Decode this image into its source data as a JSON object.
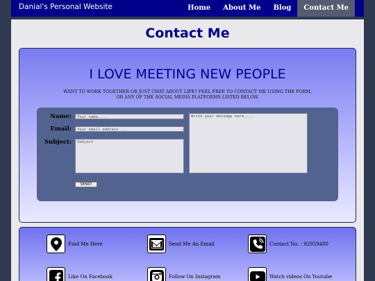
{
  "nav": {
    "brand": "Danial's Personal Website",
    "links": [
      "Home",
      "About Me",
      "Blog",
      "Contact Me"
    ],
    "active_index": 3
  },
  "page_title": "Contact Me",
  "contact": {
    "headline": "I LOVE MEETING NEW PEOPLE",
    "intro_line1": "WANT TO WORK TOGETHER OR JUST CHAT ABOUT LIFE? FEEL FREE TO CONTACT ME USING THE FORM,",
    "intro_line2": "OR ANY OF THE SOCIAL MEDIA PLATFORMS LISTED BELOW.",
    "form": {
      "name_label": "Name:",
      "name_placeholder": "Your name....",
      "email_label": "Email:",
      "email_placeholder": "Your email address ...",
      "subject_label": "Subject:",
      "subject_placeholder": "Subject",
      "message_placeholder": "Write your message here....",
      "send_label": "SEND!"
    }
  },
  "social": [
    {
      "icon": "location-pin-icon",
      "text": "Find Me Here"
    },
    {
      "icon": "email-icon",
      "text": "Send Me An Email"
    },
    {
      "icon": "phone-icon",
      "text": "Contact No. : 92959480"
    },
    {
      "icon": "facebook-icon",
      "text": "Like On Facebook"
    },
    {
      "icon": "instagram-icon",
      "text": "Follow On Instagram"
    },
    {
      "icon": "youtube-icon",
      "text": "Watch videos On Youtube"
    }
  ],
  "colors": {
    "nav_bg": "#00008b",
    "accent": "#00008b",
    "panel": "#53638f",
    "page_bg": "#2f3950"
  }
}
